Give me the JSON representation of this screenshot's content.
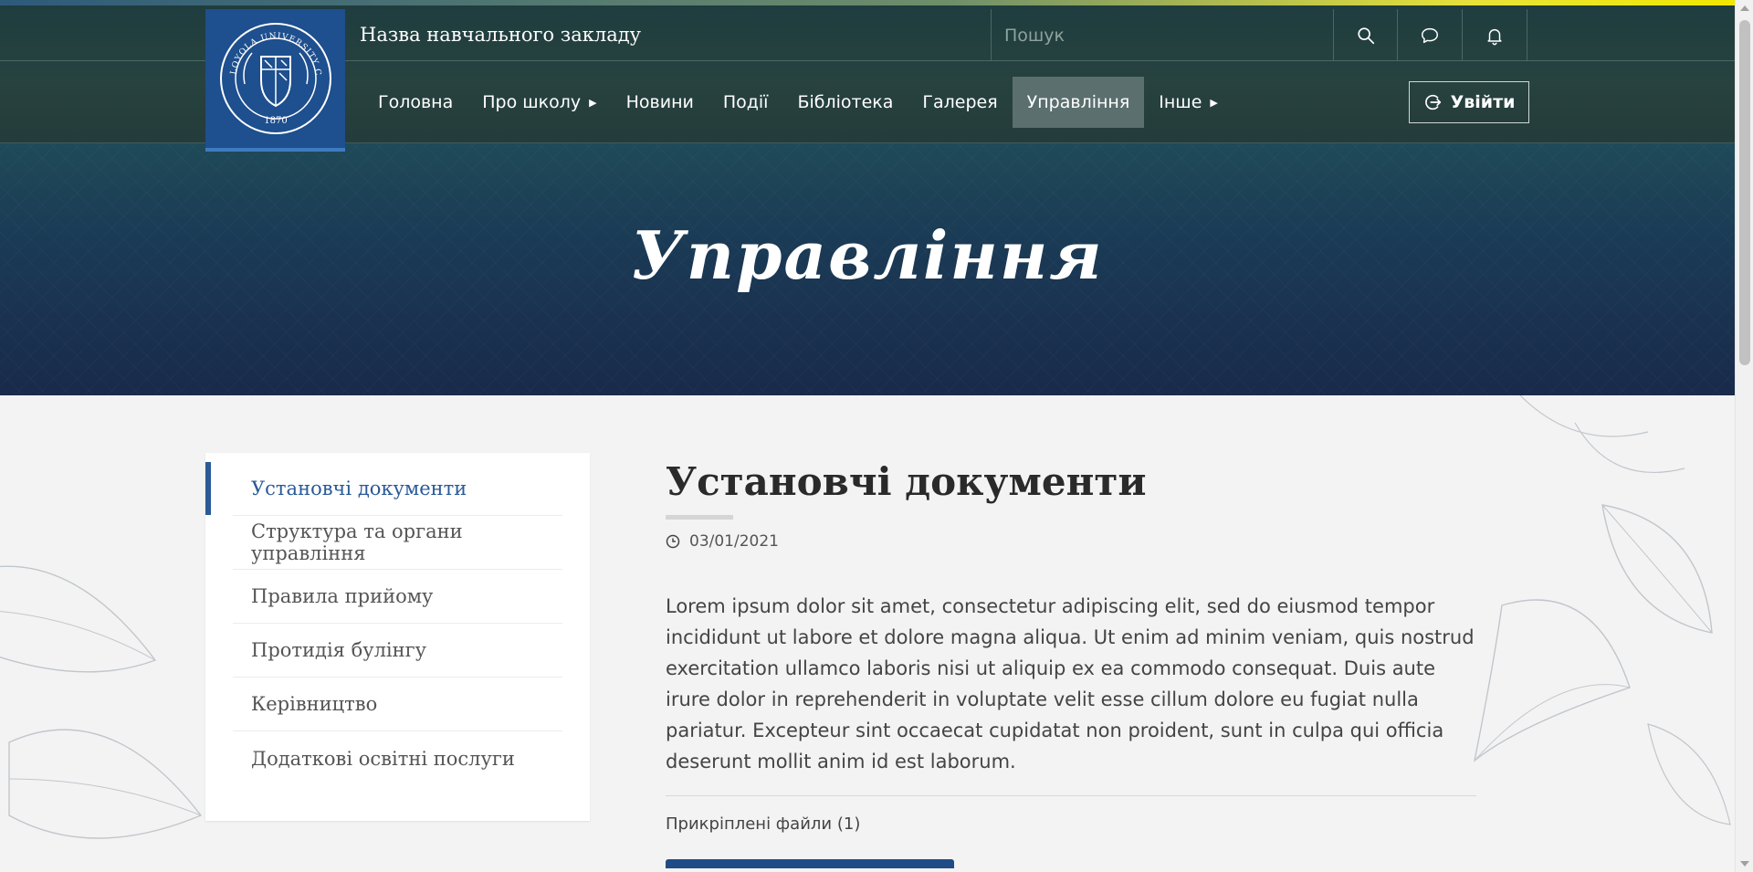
{
  "header": {
    "school_name": "Назва навчального закладу",
    "search": {
      "placeholder": "Пошук"
    },
    "icons": [
      "search-icon",
      "chat-icon",
      "bell-icon"
    ],
    "login_label": "Увійти",
    "logo_text": "LOYOLA UNIVERSITY CHICAGO",
    "logo_year": "1870"
  },
  "nav": {
    "items": [
      {
        "label": "Головна",
        "has_dropdown": false,
        "active": false
      },
      {
        "label": "Про школу",
        "has_dropdown": true,
        "active": false
      },
      {
        "label": "Новини",
        "has_dropdown": false,
        "active": false
      },
      {
        "label": "Події",
        "has_dropdown": false,
        "active": false
      },
      {
        "label": "Бібліотека",
        "has_dropdown": false,
        "active": false
      },
      {
        "label": "Галерея",
        "has_dropdown": false,
        "active": false
      },
      {
        "label": "Управління",
        "has_dropdown": false,
        "active": true
      },
      {
        "label": "Інше",
        "has_dropdown": true,
        "active": false
      }
    ]
  },
  "banner": {
    "title": "Управління"
  },
  "sidebar": {
    "items": [
      {
        "label": "Установчі документи",
        "active": true
      },
      {
        "label": "Структура та органи управління",
        "active": false
      },
      {
        "label": "Правила прийому",
        "active": false
      },
      {
        "label": "Протидія булінгу",
        "active": false
      },
      {
        "label": "Керівництво",
        "active": false
      },
      {
        "label": "Додаткові освітні послуги",
        "active": false
      }
    ]
  },
  "article": {
    "title": "Установчі документи",
    "date": "03/01/2021",
    "body": "Lorem ipsum dolor sit amet, consectetur adipiscing elit, sed do eiusmod tempor incididunt ut labore et dolore magna aliqua. Ut enim ad minim veniam, quis nostrud exercitation ullamco laboris nisi ut aliquip ex ea commodo consequat. Duis aute irure dolor in reprehenderit in voluptate velit esse cillum dolore eu fugiat nulla pariatur. Excepteur sint occaecat cupidatat non proident, sunt in culpa qui officia deserunt mollit anim id est laborum.",
    "attachments_label": "Прикріплені файли (1)"
  },
  "colors": {
    "header_bg": "#243e3c",
    "logo_bg": "#1e4f8e",
    "active_nav_bg": "#5a6f6e",
    "sidebar_active": "#2a5a97",
    "banner_bg": "#1a3a55"
  }
}
